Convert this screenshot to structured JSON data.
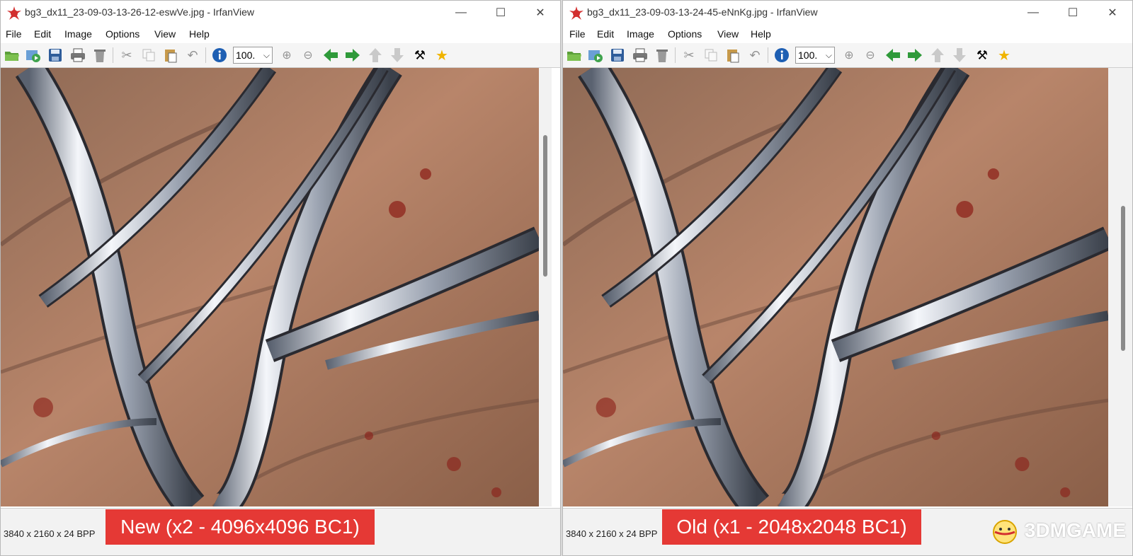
{
  "left": {
    "title": "bg3_dx11_23-09-03-13-26-12-eswVe.jpg - IrfanView",
    "zoom": "100.",
    "status": "3840 x 2160 x 24 BPP",
    "caption": "New (x2 - 4096x4096 BC1)"
  },
  "right": {
    "title": "bg3_dx11_23-09-03-13-24-45-eNnKg.jpg - IrfanView",
    "zoom": "100.",
    "status": "3840 x 2160 x 24 BPP",
    "caption": "Old (x1 - 2048x2048 BC1)"
  },
  "menu": {
    "file": "File",
    "edit": "Edit",
    "image": "Image",
    "options": "Options",
    "view": "View",
    "help": "Help"
  },
  "watermark": "3DMGAME",
  "colors": {
    "caption_bg": "#e53935",
    "skin": "#a8775a",
    "metal": "#e0e4ea"
  },
  "icons": [
    "open-icon",
    "slideshow-icon",
    "save-icon",
    "print-icon",
    "delete-icon",
    "cut-icon",
    "copy-icon",
    "paste-icon",
    "undo-icon",
    "info-icon",
    "zoom-in-icon",
    "zoom-out-icon",
    "prev-icon",
    "next-icon",
    "up-icon",
    "down-icon",
    "settings-icon",
    "favorite-icon"
  ]
}
